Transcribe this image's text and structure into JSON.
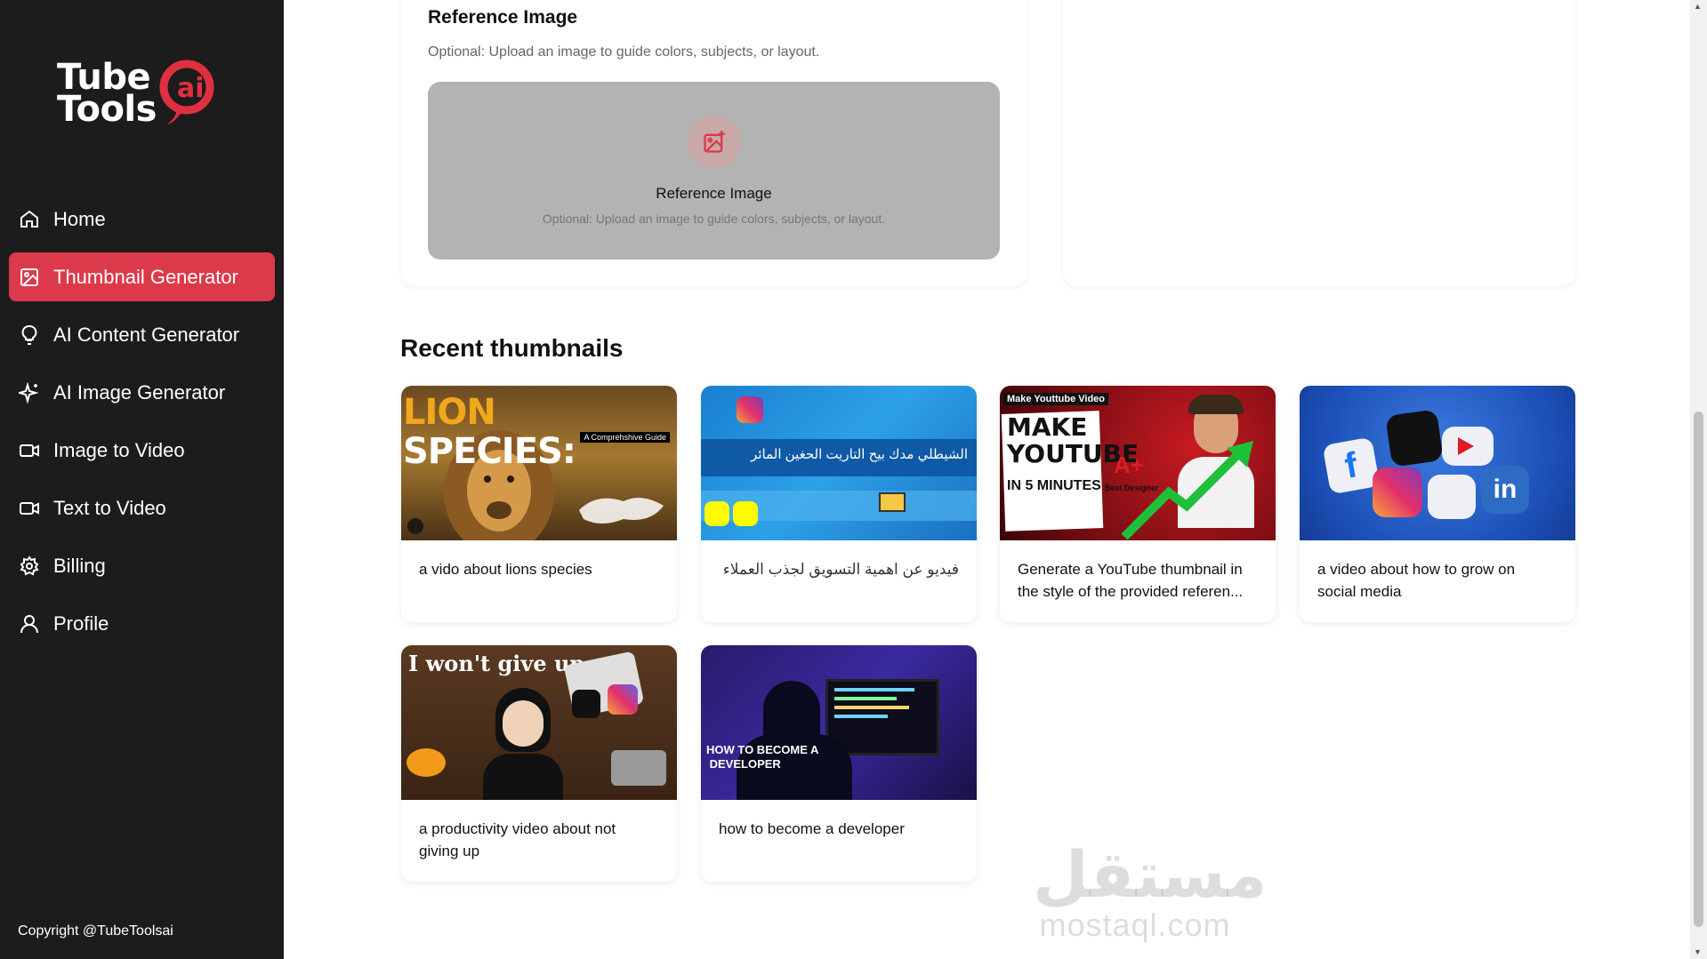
{
  "sidebar": {
    "logo": {
      "line1": "Tube",
      "line2": "Tools",
      "badge": "ai"
    },
    "items": [
      {
        "label": "Home",
        "icon": "home-icon"
      },
      {
        "label": "Thumbnail Generator",
        "icon": "image-icon",
        "active": true
      },
      {
        "label": "AI Content Generator",
        "icon": "lightbulb-icon"
      },
      {
        "label": "AI Image Generator",
        "icon": "sparkles-icon"
      },
      {
        "label": "Image to Video",
        "icon": "video-icon"
      },
      {
        "label": "Text to Video",
        "icon": "video-icon"
      },
      {
        "label": "Billing",
        "icon": "gear-icon"
      },
      {
        "label": "Profile",
        "icon": "user-icon"
      }
    ],
    "copyright": "Copyright @TubeToolsai"
  },
  "reference": {
    "title": "Reference Image",
    "subtitle": "Optional: Upload an image to guide colors, subjects, or layout.",
    "drop_title": "Reference Image",
    "drop_subtitle": "Optional: Upload an image to guide colors, subjects, or layout."
  },
  "recent": {
    "title": "Recent thumbnails",
    "items": [
      {
        "caption": "a vido about lions species",
        "image_text": "LION SPECIES:",
        "image_sub": "A Comprehshive Guide"
      },
      {
        "caption": "فيديو عن اهمية التسويق لجذب العملاء",
        "image_text": "الشيطلي مدك بيح التاريت الحغين المائر"
      },
      {
        "caption": "Generate a YouTube thumbnail in the style of the provided referen...",
        "image_tag": "Make Youttube Video",
        "image_text": "MAKE YOUTUBE",
        "image_sub": "IN 5 MINUTES",
        "image_badge": "A+",
        "image_badge_sub": "Best Designer"
      },
      {
        "caption": "a video about how to grow on social media"
      },
      {
        "caption": "a productivity video about not giving up",
        "image_text": "I won't give up."
      },
      {
        "caption": "how to become a developer",
        "image_text": "HOW TO BECOME A DEVELOPER"
      }
    ]
  },
  "watermark": {
    "arabic": "مستقل",
    "latin": "mostaql.com"
  },
  "colors": {
    "sidebar_bg": "#1c1c1c",
    "accent": "#dc3a4a"
  }
}
